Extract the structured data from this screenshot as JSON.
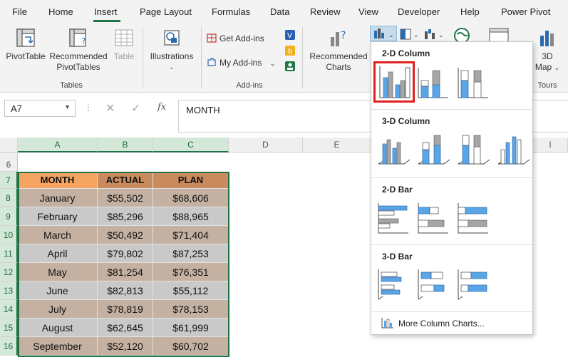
{
  "menu": [
    "File",
    "Home",
    "Insert",
    "Page Layout",
    "Formulas",
    "Data",
    "Review",
    "View",
    "Developer",
    "Help",
    "Power Pivot"
  ],
  "ribbon": {
    "pivot_table": "PivotTable",
    "recommended_pivot_1": "Recommended",
    "recommended_pivot_2": "PivotTables",
    "table": "Table",
    "tables_group": "Tables",
    "illustrations": "Illustrations",
    "get_addins": "Get Add-ins",
    "my_addins": "My Add-ins",
    "addins_group": "Add-ins",
    "recommended_charts_1": "Recommended",
    "recommended_charts_2": "Charts",
    "map_1": "3D",
    "map_2": "Map",
    "tours_group": "Tours"
  },
  "formula_bar": {
    "name_box": "A7",
    "content": "MONTH"
  },
  "colors": {
    "excel_green": "#217346",
    "header_orange": "#f4a460",
    "header_brown": "#c98a5e",
    "row_tan": "#c4b1a1",
    "row_gray": "#c9c9c9",
    "chart_blue": "#5aa5e6",
    "chart_gray": "#a6a6a6",
    "highlight_red": "#e02020"
  },
  "columns": [
    "A",
    "B",
    "C",
    "D",
    "E",
    "I"
  ],
  "rows": [
    "6",
    "7",
    "8",
    "9",
    "10",
    "11",
    "12",
    "13",
    "14",
    "15",
    "16"
  ],
  "table": {
    "headers": [
      "MONTH",
      "ACTUAL",
      "PLAN"
    ],
    "data": [
      [
        "January",
        "$55,502",
        "$68,606"
      ],
      [
        "February",
        "$85,296",
        "$88,965"
      ],
      [
        "March",
        "$50,492",
        "$71,404"
      ],
      [
        "April",
        "$79,802",
        "$87,253"
      ],
      [
        "May",
        "$81,254",
        "$76,351"
      ],
      [
        "June",
        "$82,813",
        "$55,112"
      ],
      [
        "July",
        "$78,819",
        "$78,153"
      ],
      [
        "August",
        "$62,645",
        "$61,999"
      ],
      [
        "September",
        "$52,120",
        "$60,702"
      ]
    ]
  },
  "dropdown": {
    "section_2d_column": "2-D Column",
    "section_3d_column": "3-D Column",
    "section_2d_bar": "2-D Bar",
    "section_3d_bar": "3-D Bar",
    "more_charts": "More Column Charts..."
  }
}
